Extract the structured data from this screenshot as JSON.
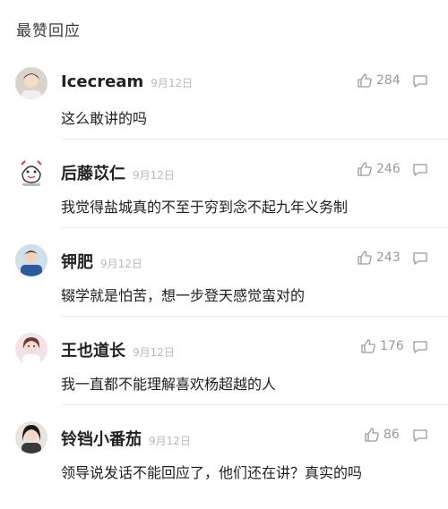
{
  "section": {
    "title": "最赞回应"
  },
  "comments": [
    {
      "user": "Icecream",
      "date": "9月12日",
      "likes": "284",
      "text": "这么敢讲的吗"
    },
    {
      "user": "后藤苡仁",
      "date": "9月12日",
      "likes": "246",
      "text": "我觉得盐城真的不至于穷到念不起九年义务制"
    },
    {
      "user": "钾肥",
      "date": "9月12日",
      "likes": "243",
      "text": "辍学就是怕苦，想一步登天感觉蛮对的"
    },
    {
      "user": "王也道长",
      "date": "9月12日",
      "likes": "176",
      "text": "我一直都不能理解喜欢杨超越的人"
    },
    {
      "user": "铃铛小番茄",
      "date": "9月12日",
      "likes": "86",
      "text": "领导说发话不能回应了，他们还在讲？真实的吗"
    }
  ],
  "icons": {
    "like": "thumbs-up-icon",
    "reply": "comment-bubble-icon"
  },
  "colors": {
    "text": "#1e1e1e",
    "meta": "#b9b9b9",
    "divider": "#ececec"
  }
}
